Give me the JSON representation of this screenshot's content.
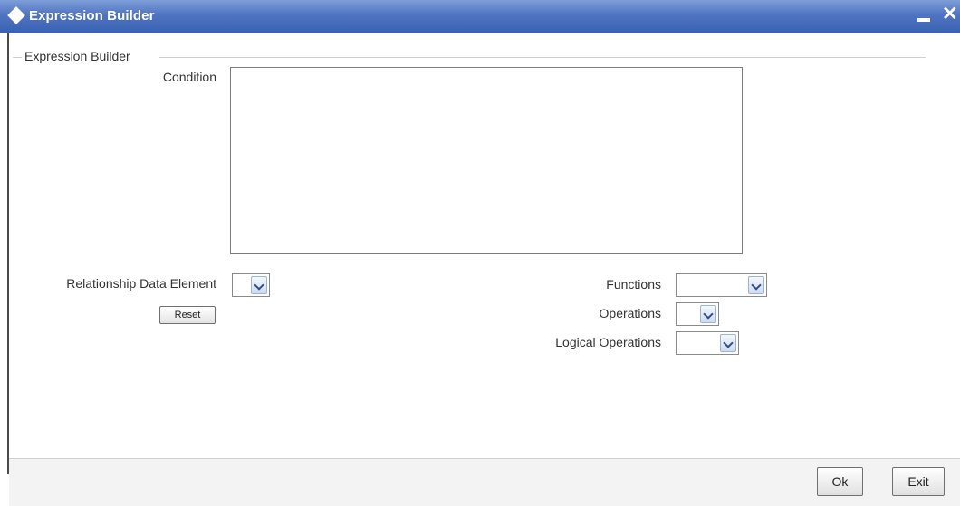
{
  "window": {
    "title": "Expression Builder",
    "minimize_label": "",
    "close_label": "✕"
  },
  "section": {
    "legend": "Expression Builder"
  },
  "condition": {
    "label": "Condition",
    "value": ""
  },
  "relationship": {
    "label": "Relationship Data Element",
    "value": ""
  },
  "reset": {
    "label": "Reset"
  },
  "functions": {
    "label": "Functions",
    "value": ""
  },
  "operations": {
    "label": "Operations",
    "value": ""
  },
  "logical": {
    "label": "Logical Operations",
    "value": ""
  },
  "footer": {
    "ok_label": "Ok",
    "exit_label": "Exit"
  },
  "colors": {
    "titlebar": "#4f74c1",
    "footer": "#f3f3f3"
  }
}
